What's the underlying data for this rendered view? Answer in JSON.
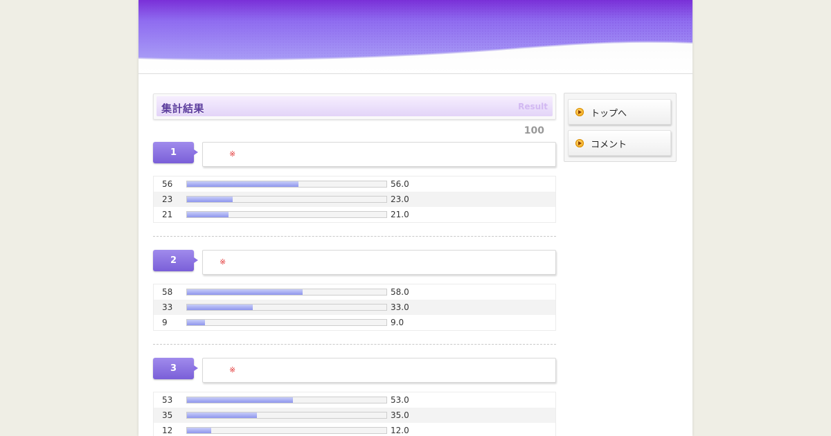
{
  "colors": {
    "header_purple": "#8f72f0",
    "bar_fill": "#8e96ee",
    "question_badge": "#7a5fd8",
    "title_text": "#5c3c9e",
    "icon_orange": "#f0a30a",
    "mark_red": "#e23333"
  },
  "results_panel": {
    "title": "集計結果",
    "title_en": "Result",
    "total": "100"
  },
  "questions": [
    {
      "number": "1",
      "mark": "※",
      "rows": [
        {
          "count": "56",
          "percent": "56.0",
          "fraction": 0.56
        },
        {
          "count": "23",
          "percent": "23.0",
          "fraction": 0.23
        },
        {
          "count": "21",
          "percent": "21.0",
          "fraction": 0.21
        }
      ]
    },
    {
      "number": "2",
      "mark": "※",
      "rows": [
        {
          "count": "58",
          "percent": "58.0",
          "fraction": 0.58
        },
        {
          "count": "33",
          "percent": "33.0",
          "fraction": 0.33
        },
        {
          "count": "9",
          "percent": "9.0",
          "fraction": 0.09
        }
      ]
    },
    {
      "number": "3",
      "mark": "※",
      "rows": [
        {
          "count": "53",
          "percent": "53.0",
          "fraction": 0.53
        },
        {
          "count": "35",
          "percent": "35.0",
          "fraction": 0.35
        },
        {
          "count": "12",
          "percent": "12.0",
          "fraction": 0.12
        }
      ]
    }
  ],
  "sidebar": {
    "items": [
      {
        "label": "トップへ",
        "icon": "play-circle-icon"
      },
      {
        "label": "コメント",
        "icon": "play-circle-icon"
      }
    ]
  }
}
